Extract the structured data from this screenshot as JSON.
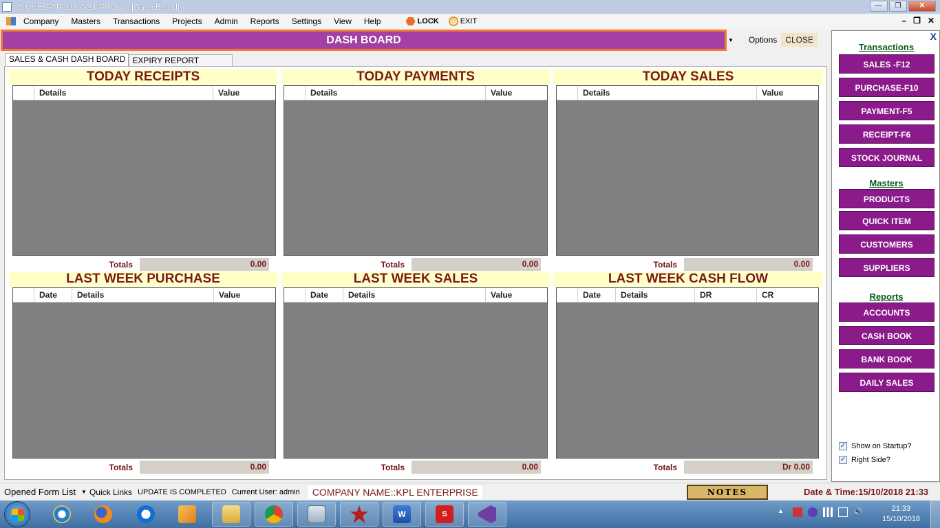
{
  "window": {
    "title": "SKY ERP PLUS GST PRO 7 - [Dash Board]"
  },
  "menu": {
    "items": [
      "Company",
      "Masters",
      "Transactions",
      "Projects",
      "Admin",
      "Reports",
      "Settings",
      "View",
      "Help"
    ],
    "lock": "LOCK",
    "exit": "EXIT"
  },
  "header": {
    "title": "DASH BOARD",
    "options": "Options",
    "close": "CLOSE"
  },
  "tabs": [
    "SALES & CASH DASH BOARD",
    "EXPIRY REPORT"
  ],
  "panels": [
    {
      "title": "TODAY RECEIPTS",
      "columns": [
        "",
        "Details",
        "Value"
      ],
      "totals_label": "Totals",
      "total": "0.00"
    },
    {
      "title": "TODAY PAYMENTS",
      "columns": [
        "",
        "Details",
        "Value"
      ],
      "totals_label": "Totals",
      "total": "0.00"
    },
    {
      "title": "TODAY SALES",
      "columns": [
        "",
        "Details",
        "Value"
      ],
      "totals_label": "Totals",
      "total": "0.00"
    },
    {
      "title": "LAST WEEK PURCHASE",
      "columns": [
        "",
        "Date",
        "Details",
        "Value"
      ],
      "totals_label": "Totals",
      "total": "0.00"
    },
    {
      "title": "LAST WEEK SALES",
      "columns": [
        "",
        "Date",
        "Details",
        "Value"
      ],
      "totals_label": "Totals",
      "total": "0.00"
    },
    {
      "title": "LAST WEEK CASH FLOW",
      "columns": [
        "",
        "Date",
        "Details",
        "DR",
        "CR"
      ],
      "totals_label": "Totals",
      "total": "Dr 0.00"
    }
  ],
  "sidebar": {
    "close": "X",
    "sections": [
      {
        "title": "Transactions",
        "buttons": [
          "SALES -F12",
          "PURCHASE-F10",
          "PAYMENT-F5",
          "RECEIPT-F6",
          "STOCK JOURNAL"
        ]
      },
      {
        "title": "Masters",
        "buttons": [
          "PRODUCTS",
          "QUICK ITEM",
          "CUSTOMERS",
          "SUPPLIERS"
        ]
      },
      {
        "title": "Reports",
        "buttons": [
          "ACCOUNTS",
          "CASH BOOK",
          "BANK BOOK",
          "DAILY SALES"
        ]
      }
    ],
    "checkboxes": [
      {
        "label": "Show on Startup?",
        "checked": true
      },
      {
        "label": "Right Side?",
        "checked": true
      }
    ]
  },
  "status": {
    "opened_forms": "Opened Form List",
    "quick_links": "Quick Links",
    "update": "UPDATE IS COMPLETED",
    "user": "Current User: admin",
    "company": "COMPANY NAME::KPL ENTERPRISE",
    "notes": "NOTES",
    "datetime": "Date & Time:15/10/2018 21:33"
  },
  "taskbar": {
    "apps": [
      "internet-explorer-icon",
      "firefox-icon",
      "teamviewer-icon",
      "media-player-icon",
      "file-explorer-icon",
      "chrome-icon",
      "calculator-icon",
      "app-red-icon",
      "word-icon",
      "sky-icon",
      "visual-studio-icon"
    ],
    "clock_time": "21:33",
    "clock_date": "15/10/2018"
  },
  "colors": {
    "header_purple": "#a43fa3",
    "header_border": "#f07b2d",
    "sidebar_button": "#8b1a8b",
    "panel_title_bg": "#ffffc8",
    "panel_title_text": "#7b1a1a",
    "grid_bg": "#808080"
  }
}
